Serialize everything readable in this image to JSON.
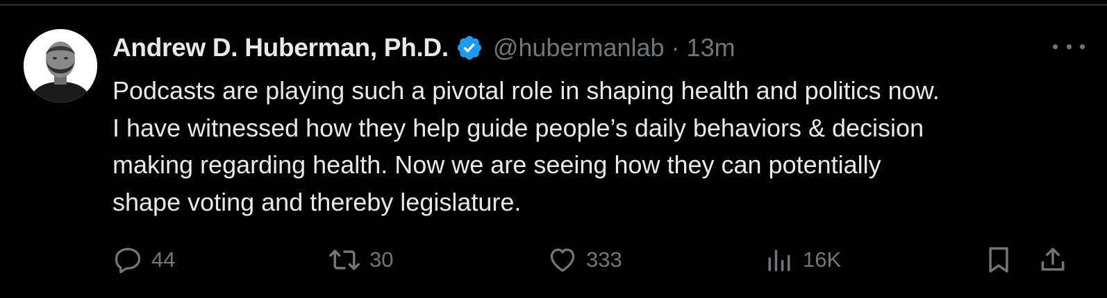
{
  "tweet": {
    "author": {
      "display_name": "Andrew D. Huberman, Ph.D.",
      "handle": "@hubermanlab",
      "verified_icon": "verified-badge-icon",
      "avatar": "profile-photo"
    },
    "separator": "·",
    "time": "13m",
    "text_lines": [
      "Podcasts are playing such a pivotal role in shaping health and politics now.",
      "I have witnessed how they help guide people’s daily behaviors & decision",
      "making regarding health. Now we are seeing how they can potentially",
      "shape voting and thereby legislature."
    ],
    "actions": {
      "reply": {
        "icon": "reply-icon",
        "count": "44"
      },
      "retweet": {
        "icon": "retweet-icon",
        "count": "30"
      },
      "like": {
        "icon": "heart-icon",
        "count": "333"
      },
      "views": {
        "icon": "views-icon",
        "count": "16K"
      },
      "bookmark": {
        "icon": "bookmark-icon"
      },
      "share": {
        "icon": "share-icon"
      }
    },
    "more_icon": "more-icon"
  },
  "colors": {
    "background": "#000000",
    "primary_text": "#e7e9ea",
    "secondary_text": "#71767b",
    "verified_blue": "#1d9bf0",
    "divider": "#2f3336"
  }
}
